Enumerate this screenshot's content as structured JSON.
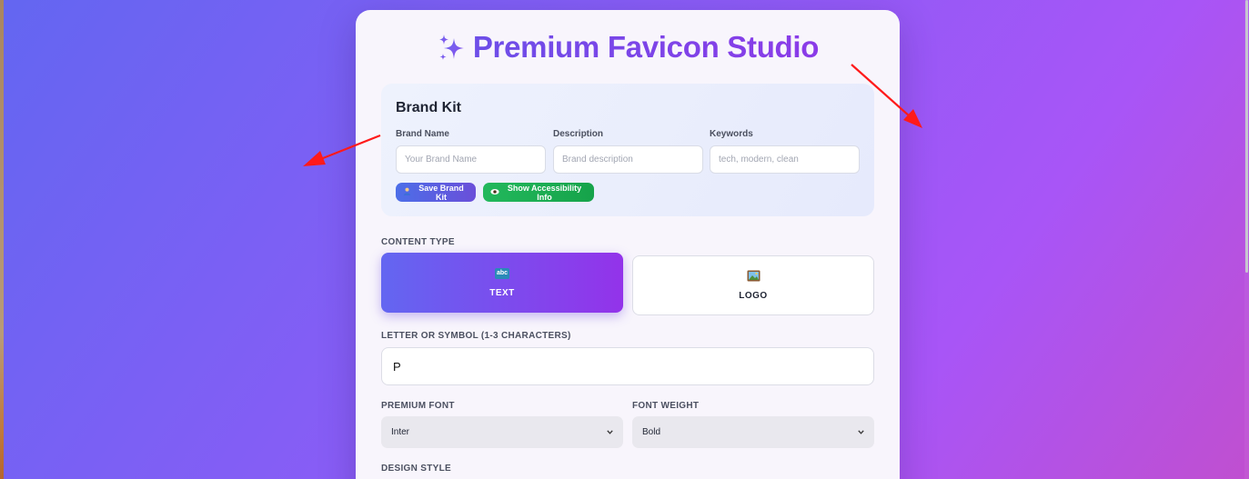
{
  "app": {
    "title": "Premium Favicon Studio"
  },
  "brand_kit": {
    "heading": "Brand Kit",
    "fields": {
      "brand_name": {
        "label": "Brand Name",
        "placeholder": "Your Brand Name",
        "value": ""
      },
      "description": {
        "label": "Description",
        "placeholder": "Brand description",
        "value": ""
      },
      "keywords": {
        "label": "Keywords",
        "placeholder": "tech, modern, clean",
        "value": ""
      }
    },
    "buttons": {
      "save": {
        "icon": "user-icon",
        "label": "Save Brand Kit"
      },
      "accessibility": {
        "icon": "eye-icon",
        "label": "Show Accessibility Info"
      }
    }
  },
  "content_type": {
    "label": "CONTENT TYPE",
    "options": [
      {
        "icon": "abc-icon",
        "icon_text": "abc",
        "label": "TEXT",
        "selected": true
      },
      {
        "icon": "framed-picture-icon",
        "label": "LOGO",
        "selected": false
      }
    ]
  },
  "letter": {
    "label": "LETTER OR SYMBOL (1-3 CHARACTERS)",
    "value": "P"
  },
  "font": {
    "label": "PREMIUM FONT",
    "selected": "Inter"
  },
  "weight": {
    "label": "FONT WEIGHT",
    "selected": "Bold"
  },
  "design_style": {
    "label": "DESIGN STYLE"
  },
  "colors": {
    "accent": "#7c3aed",
    "text_card_gradient_start": "#6366f1",
    "text_card_gradient_end": "#9333ea",
    "save_button": "#5a5fe0",
    "accessibility_button": "#16a34a",
    "annotation_arrow": "#ff1a1a"
  }
}
